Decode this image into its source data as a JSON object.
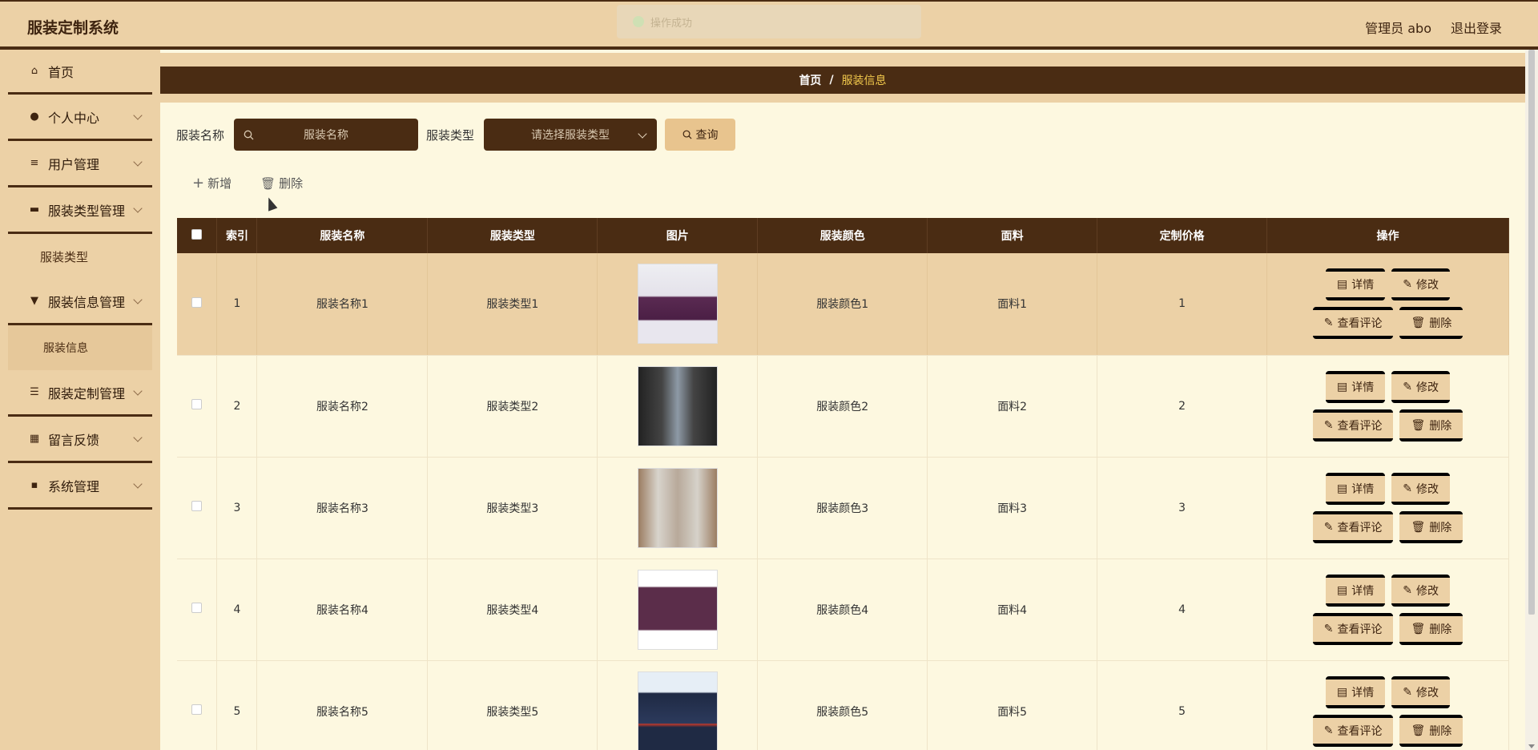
{
  "header": {
    "app_title": "服装定制系统",
    "toast": "操作成功",
    "user": "管理员 abo",
    "logout": "退出登录"
  },
  "sidebar": {
    "items": [
      {
        "label": "首页",
        "icon": "home-icon"
      },
      {
        "label": "个人中心",
        "icon": "user-icon"
      },
      {
        "label": "用户管理",
        "icon": "sliders-icon"
      },
      {
        "label": "服装类型管理",
        "icon": "briefcase-icon"
      },
      {
        "label": "服装类型",
        "icon": ""
      },
      {
        "label": "服装信息管理",
        "icon": "pin-icon"
      },
      {
        "label": "服装信息",
        "icon": ""
      },
      {
        "label": "服装定制管理",
        "icon": "list-icon"
      },
      {
        "label": "留言反馈",
        "icon": "grid-icon"
      },
      {
        "label": "系统管理",
        "icon": "apps-icon"
      }
    ]
  },
  "breadcrumb": {
    "home": "首页",
    "sep": "/",
    "current": "服装信息"
  },
  "search": {
    "name_label": "服装名称",
    "name_placeholder": "服装名称",
    "type_label": "服装类型",
    "type_placeholder": "请选择服装类型",
    "query_button": "查询"
  },
  "actions": {
    "add": "新增",
    "delete": "删除"
  },
  "table": {
    "headers": [
      "索引",
      "服装名称",
      "服装类型",
      "图片",
      "服装颜色",
      "面料",
      "定制价格",
      "操作"
    ],
    "rows": [
      {
        "index": "1",
        "name": "服装名称1",
        "type": "服装类型1",
        "color": "服装颜色1",
        "fabric": "面料1",
        "price": "1"
      },
      {
        "index": "2",
        "name": "服装名称2",
        "type": "服装类型2",
        "color": "服装颜色2",
        "fabric": "面料2",
        "price": "2"
      },
      {
        "index": "3",
        "name": "服装名称3",
        "type": "服装类型3",
        "color": "服装颜色3",
        "fabric": "面料3",
        "price": "3"
      },
      {
        "index": "4",
        "name": "服装名称4",
        "type": "服装类型4",
        "color": "服装颜色4",
        "fabric": "面料4",
        "price": "4"
      },
      {
        "index": "5",
        "name": "服装名称5",
        "type": "服装类型5",
        "color": "服装颜色5",
        "fabric": "面料5",
        "price": "5"
      }
    ],
    "op_labels": {
      "detail": "详情",
      "edit": "修改",
      "comments": "查看评论",
      "delete": "删除"
    }
  },
  "colors": {
    "brand_dark": "#4a2c13",
    "brand_light": "#ecd1a6",
    "accent": "#f2c94c",
    "bg": "#fdf8e0"
  }
}
